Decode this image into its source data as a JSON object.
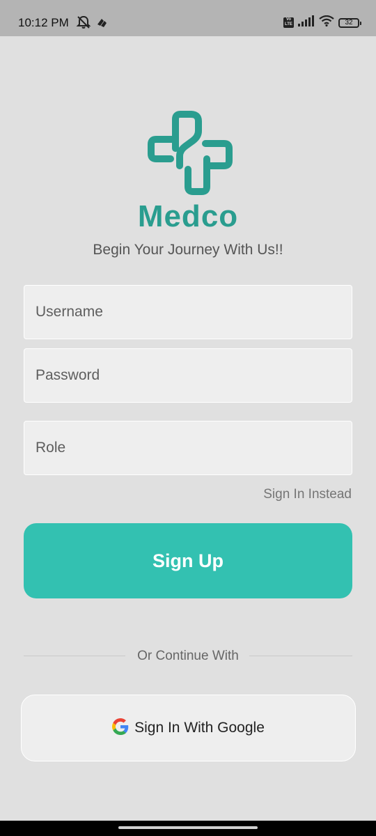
{
  "status_bar": {
    "time": "10:12 PM",
    "left_icons": [
      "bell-off-icon",
      "app-notification-icon"
    ],
    "volte_label": "Vo LTE",
    "right_icons": [
      "signal-icon",
      "wifi-icon"
    ],
    "battery_level": "32"
  },
  "logo": {
    "icon": "medical-cross-logo-icon",
    "app_name": "Medco",
    "color": "#2a9d8f"
  },
  "tagline": "Begin Your Journey With Us!!",
  "form": {
    "username_placeholder": "Username",
    "password_placeholder": "Password",
    "role_placeholder": "Role"
  },
  "links": {
    "sign_in_instead": "Sign In Instead"
  },
  "buttons": {
    "sign_up": "Sign Up",
    "sign_up_color": "#33c1b1",
    "google": "Sign In With Google",
    "google_icon": "google-logo-icon"
  },
  "divider": {
    "text": "Or Continue With"
  }
}
